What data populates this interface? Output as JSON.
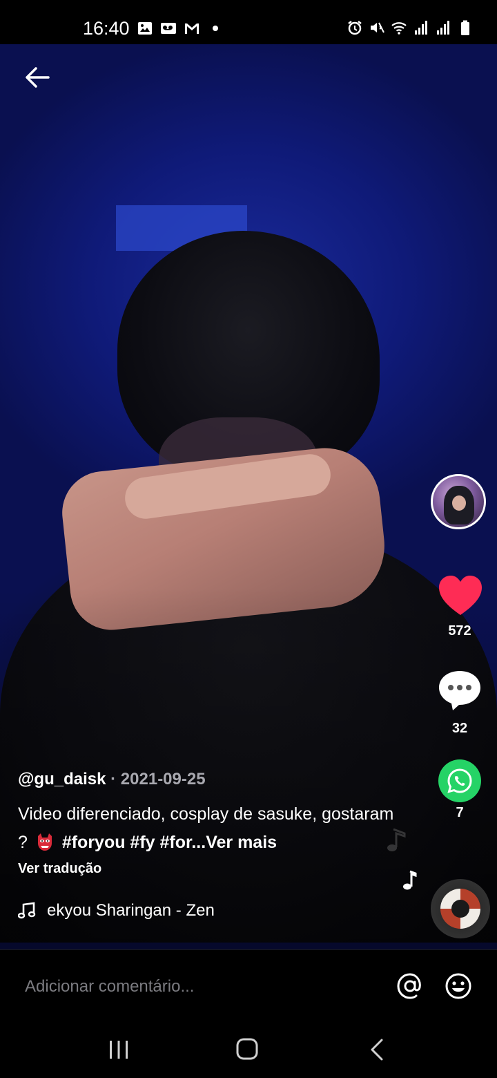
{
  "status_bar": {
    "time": "16:40",
    "left_icons": [
      "image-icon",
      "voicemail-icon",
      "gmail-icon",
      "dot-icon"
    ],
    "right_icons": [
      "alarm-icon",
      "mute-icon",
      "wifi-icon",
      "signal-icon",
      "signal-icon",
      "battery-icon"
    ]
  },
  "post": {
    "username": "@gu_daisk",
    "separator": "·",
    "date": "2021-09-25",
    "description_text": "Video diferenciado, cosplay de sasuke, gostaram ? ",
    "hashtags": "#foryou #fy #for...",
    "see_more": "Ver mais",
    "translate": "Ver tradução",
    "music": "ekyou Sharingan - Zen"
  },
  "actions": {
    "likes": "572",
    "comments": "32",
    "shares": "7"
  },
  "comment_bar": {
    "placeholder": "Adicionar comentário..."
  },
  "colors": {
    "like_red": "#fe2c55",
    "whatsapp_green": "#25d366",
    "muted_text": "#a9a9b0"
  }
}
